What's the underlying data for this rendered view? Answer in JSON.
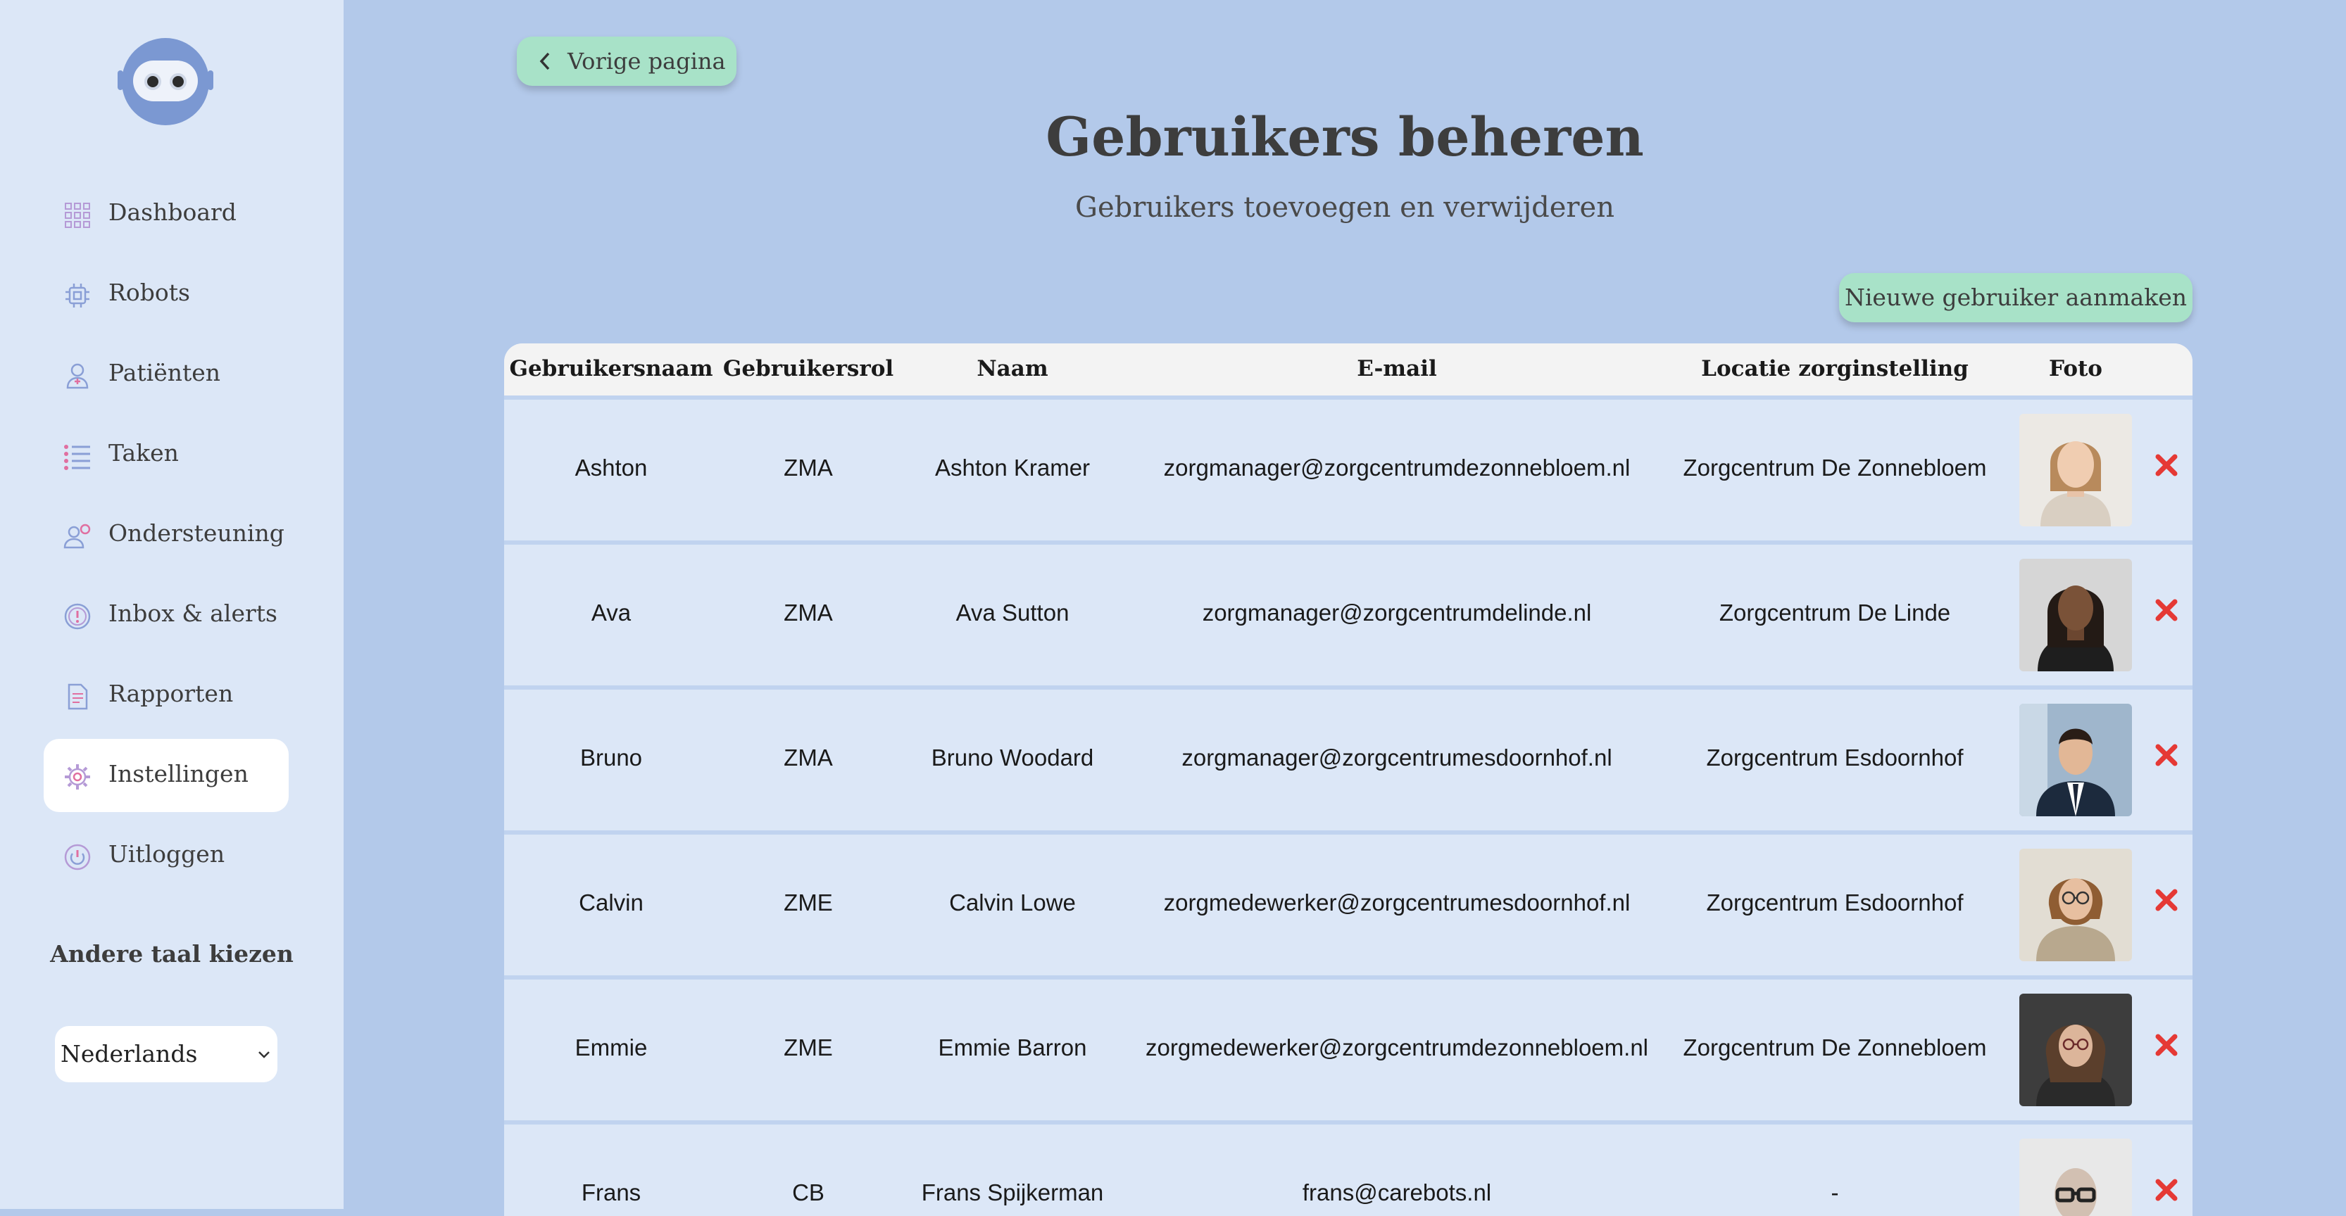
{
  "app": {
    "logo_icon": "robot-face-logo",
    "accent_color": "#a8e2c8",
    "background_color": "#b3c9ea",
    "sidebar_color": "#dce7f7"
  },
  "sidebar": {
    "items": [
      {
        "label": "Dashboard",
        "icon": "grid-icon"
      },
      {
        "label": "Robots",
        "icon": "chip-icon"
      },
      {
        "label": "Patiënten",
        "icon": "person-icon"
      },
      {
        "label": "Taken",
        "icon": "list-icon"
      },
      {
        "label": "Ondersteuning",
        "icon": "support-icon"
      },
      {
        "label": "Inbox & alerts",
        "icon": "alert-icon"
      },
      {
        "label": "Rapporten",
        "icon": "document-icon"
      },
      {
        "label": "Instellingen",
        "icon": "gear-icon",
        "active": true
      },
      {
        "label": "Uitloggen",
        "icon": "power-icon"
      }
    ],
    "language_title": "Andere taal kiezen",
    "language_value": "Nederlands"
  },
  "header": {
    "back_label": "Vorige pagina",
    "title": "Gebruikers beheren",
    "subtitle": "Gebruikers toevoegen en verwijderen",
    "new_user_label": "Nieuwe gebruiker aanmaken"
  },
  "table": {
    "columns": [
      "Gebruikersnaam",
      "Gebruikersrol",
      "Naam",
      "E-mail",
      "Locatie zorginstelling",
      "Foto"
    ],
    "rows": [
      {
        "username": "Ashton",
        "role": "ZMA",
        "name": "Ashton Kramer",
        "email": "zorgmanager@zorgcentrumdezonnebloem.nl",
        "location": "Zorgcentrum De Zonnebloem"
      },
      {
        "username": "Ava",
        "role": "ZMA",
        "name": "Ava Sutton",
        "email": "zorgmanager@zorgcentrumdelinde.nl",
        "location": "Zorgcentrum De Linde"
      },
      {
        "username": "Bruno",
        "role": "ZMA",
        "name": "Bruno Woodard",
        "email": "zorgmanager@zorgcentrumesdoornhof.nl",
        "location": "Zorgcentrum Esdoornhof"
      },
      {
        "username": "Calvin",
        "role": "ZME",
        "name": "Calvin Lowe",
        "email": "zorgmedewerker@zorgcentrumesdoornhof.nl",
        "location": "Zorgcentrum Esdoornhof"
      },
      {
        "username": "Emmie",
        "role": "ZME",
        "name": "Emmie Barron",
        "email": "zorgmedewerker@zorgcentrumdezonnebloem.nl",
        "location": "Zorgcentrum De Zonnebloem"
      },
      {
        "username": "Frans",
        "role": "CB",
        "name": "Frans Spijkerman",
        "email": "frans@carebots.nl",
        "location": "-"
      }
    ],
    "delete_icon": "close-x-icon",
    "delete_color": "#e53935"
  }
}
